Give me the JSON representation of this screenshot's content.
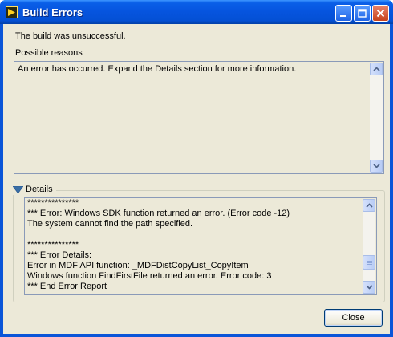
{
  "window": {
    "title": "Build Errors"
  },
  "message": "The build was unsuccessful.",
  "reasons": {
    "label": "Possible reasons",
    "text": "An error has occurred. Expand the Details section for more information."
  },
  "details": {
    "label": "Details",
    "lines": [
      "***************",
      "*** Error: Windows SDK function returned an error. (Error code -12)",
      "The system cannot find the path specified.",
      "",
      "***************",
      "*** Error Details:",
      "Error in MDF API function: _MDFDistCopyList_CopyItem",
      "Windows function FindFirstFile returned an error. Error code: 3",
      "*** End Error Report"
    ]
  },
  "buttons": {
    "close_label": "Close"
  },
  "icons": {
    "app": "labview-app-icon",
    "minimize": "minimize-icon",
    "maximize": "maximize-icon",
    "close": "close-x-icon",
    "toggle": "triangle-down-icon"
  },
  "colors": {
    "titlebar": "#0654de",
    "client": "#ece9d8",
    "border": "#8a9ab8"
  }
}
